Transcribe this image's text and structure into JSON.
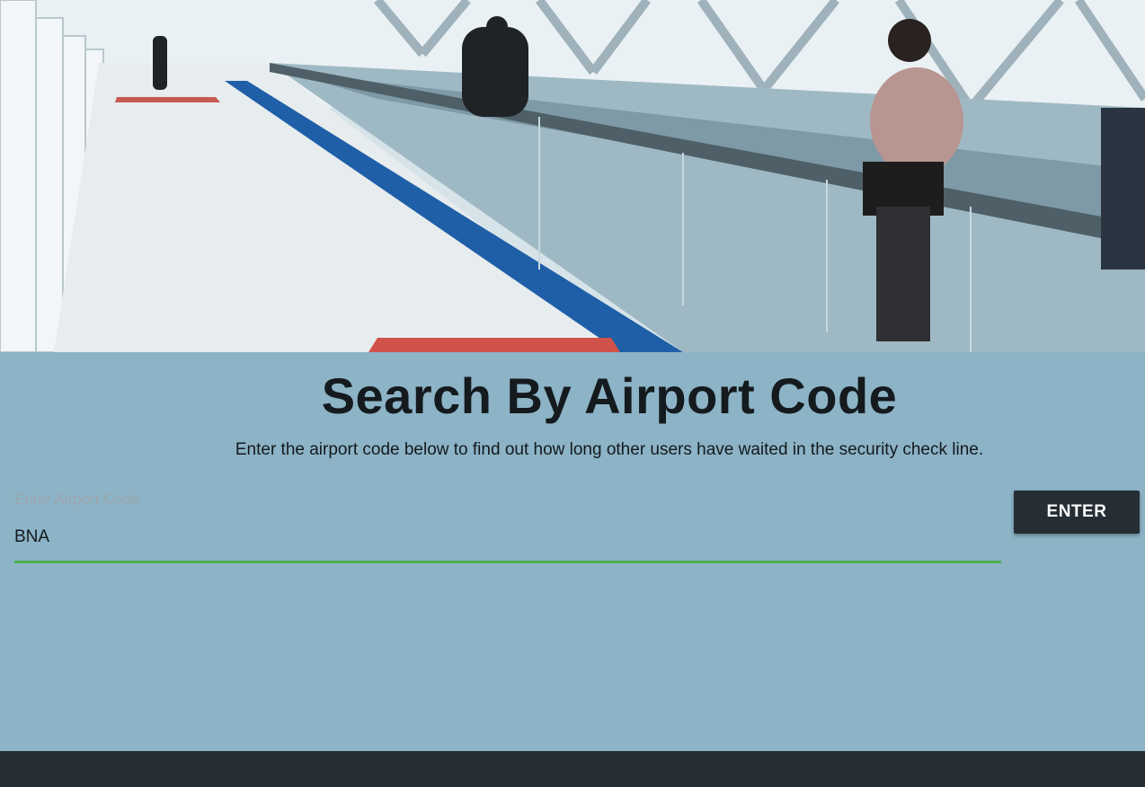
{
  "page": {
    "title": "Search By Airport Code",
    "subtitle": "Enter the airport code below to find out how long other users have waited in the security check line."
  },
  "search": {
    "label": "Enter Airport Code",
    "value": "BNA",
    "button_label": "ENTER"
  },
  "colors": {
    "background": "#8cb3c6",
    "footer": "#252e35",
    "button": "#252e35",
    "underline": "#4caf50"
  }
}
